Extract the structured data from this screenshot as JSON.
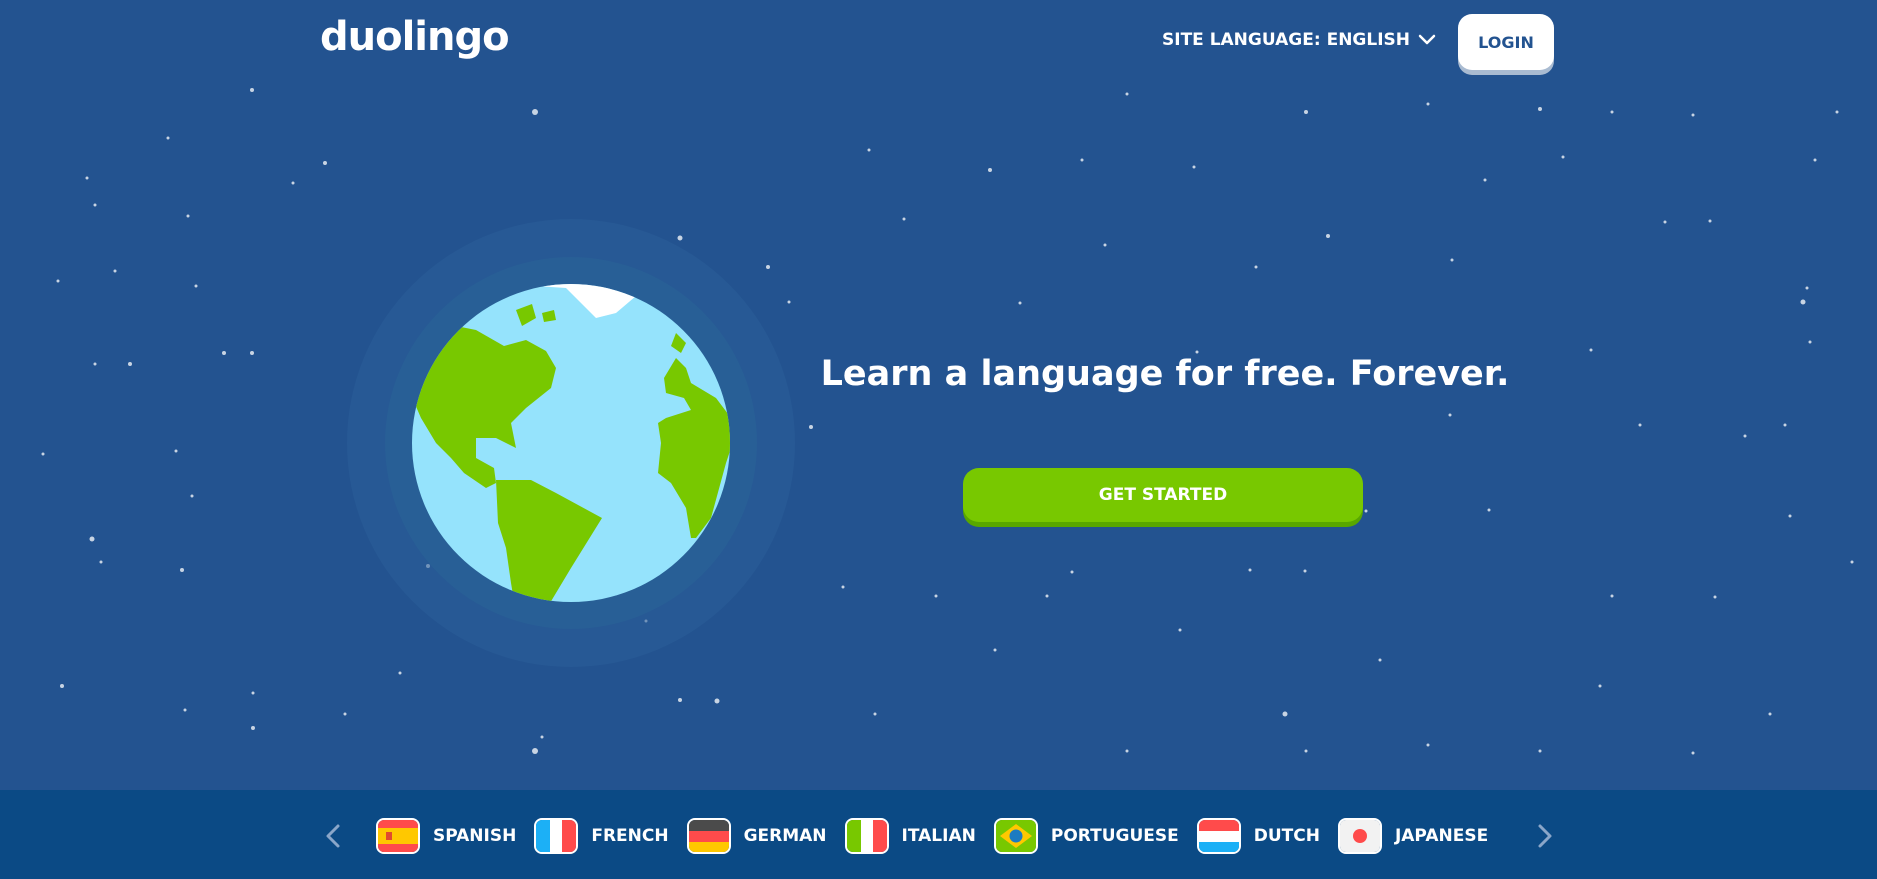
{
  "header": {
    "logo_text": "duolingo",
    "site_language_label": "SITE LANGUAGE: ENGLISH",
    "login_label": "LOGIN"
  },
  "hero": {
    "headline": "Learn a language for free. Forever.",
    "cta_label": "GET STARTED"
  },
  "language_bar": {
    "languages": [
      {
        "name": "SPANISH",
        "flag": "spain-flag"
      },
      {
        "name": "FRENCH",
        "flag": "france-flag"
      },
      {
        "name": "GERMAN",
        "flag": "germany-flag"
      },
      {
        "name": "ITALIAN",
        "flag": "italy-flag"
      },
      {
        "name": "PORTUGUESE",
        "flag": "brazil-flag"
      },
      {
        "name": "DUTCH",
        "flag": "netherlands-flag"
      },
      {
        "name": "JAPANESE",
        "flag": "japan-flag"
      }
    ]
  },
  "colors": {
    "background": "#235390",
    "language_bar": "#0b4a85",
    "cta": "#78c800",
    "ocean": "#95e3fc",
    "land": "#78c800"
  }
}
